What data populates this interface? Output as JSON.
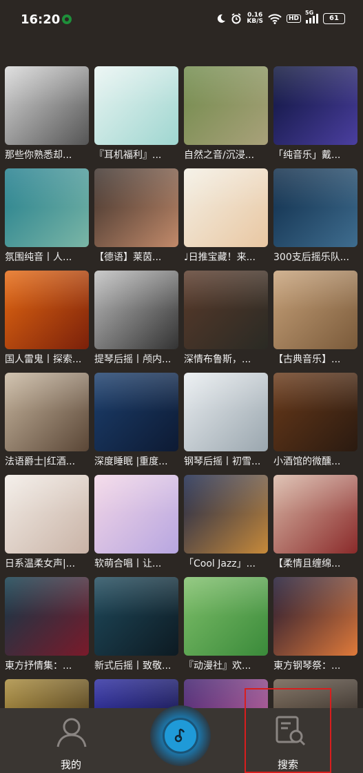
{
  "status_bar": {
    "time": "16:20",
    "net_speed_value": "0.16",
    "net_speed_unit": "KB/S",
    "hd": "HD",
    "network": "5G",
    "battery": "61"
  },
  "playlists": [
    {
      "title": "那些你熟悉却...",
      "colors": [
        "#d9d9d9",
        "#555555"
      ]
    },
    {
      "title": "『耳机福利』...",
      "colors": [
        "#e9f4f2",
        "#9fd6d0"
      ]
    },
    {
      "title": "自然之音/沉浸...",
      "colors": [
        "#6f8a4a",
        "#a9a17a"
      ]
    },
    {
      "title": "「纯音乐」戴...",
      "colors": [
        "#0b1238",
        "#4b3fa0"
      ]
    },
    {
      "title": "氛围纯音丨人...",
      "colors": [
        "#1f7c8c",
        "#7bb6a6"
      ]
    },
    {
      "title": "【德语】莱茵...",
      "colors": [
        "#3a2f2a",
        "#c28a6a"
      ]
    },
    {
      "title": "♩日推宝藏！来...",
      "colors": [
        "#f3efe4",
        "#e9c7a2"
      ]
    },
    {
      "title": "300支后摇乐队...",
      "colors": [
        "#0d2a47",
        "#3f6d8f"
      ]
    },
    {
      "title": "国人雷鬼丨探索...",
      "colors": [
        "#e66a12",
        "#7a200a"
      ]
    },
    {
      "title": "提琴后摇丨颅内...",
      "colors": [
        "#bfbfbf",
        "#333333"
      ]
    },
    {
      "title": "深情布鲁斯，...",
      "colors": [
        "#5a3a2a",
        "#2a2a24"
      ]
    },
    {
      "title": "【古典音乐】...",
      "colors": [
        "#c7a27a",
        "#7a5a3a"
      ]
    },
    {
      "title": "法语爵士|红酒...",
      "colors": [
        "#c8b7a0",
        "#5a4636"
      ]
    },
    {
      "title": "深度睡眠 |重度...",
      "colors": [
        "#1c3f6d",
        "#0d1a33"
      ]
    },
    {
      "title": "钢琴后摇丨初雪...",
      "colors": [
        "#e9edf0",
        "#9aa6ae"
      ]
    },
    {
      "title": "小酒馆的微醺...",
      "colors": [
        "#6a3a1a",
        "#2a1a10"
      ]
    },
    {
      "title": "日系温柔女声|...",
      "colors": [
        "#f2ece6",
        "#c9b3a6"
      ]
    },
    {
      "title": "软萌合唱丨让...",
      "colors": [
        "#f3d6e6",
        "#b7a6e0"
      ]
    },
    {
      "title": "「Cool Jazz」...",
      "colors": [
        "#17244a",
        "#c78a3a"
      ]
    },
    {
      "title": "【柔情且缠绵...",
      "colors": [
        "#d8b7a6",
        "#8a2a2a"
      ]
    },
    {
      "title": "東方抒情集：...",
      "colors": [
        "#0d3a4a",
        "#7a1a2a"
      ]
    },
    {
      "title": "新式后摇丨致敬...",
      "colors": [
        "#1f4a5c",
        "#0d1a22"
      ]
    },
    {
      "title": "『动漫社』欢...",
      "colors": [
        "#7fbf6a",
        "#3a8a3a"
      ]
    },
    {
      "title": "東方钢琴祭：...",
      "colors": [
        "#1a1430",
        "#e07a3a"
      ]
    },
    {
      "title": "",
      "colors": [
        "#a88a3a",
        "#3a2a10"
      ]
    },
    {
      "title": "",
      "colors": [
        "#2a2aa0",
        "#0d0d3a"
      ]
    },
    {
      "title": "",
      "colors": [
        "#3a1a6a",
        "#d06aa0"
      ]
    },
    {
      "title": "",
      "colors": [
        "#6a5a4a",
        "#2a2420"
      ]
    }
  ],
  "bottom_nav": {
    "mine_label": "我的",
    "search_label": "搜索"
  }
}
